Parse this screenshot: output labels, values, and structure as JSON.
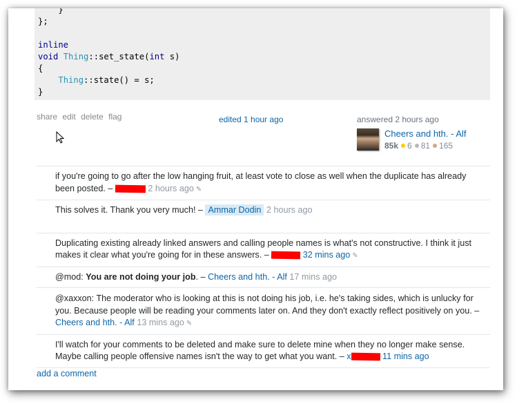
{
  "code": {
    "lines": [
      [
        {
          "t": "    }",
          "c": ""
        }
      ],
      [
        {
          "t": "};",
          "c": ""
        }
      ],
      [
        {
          "t": "",
          "c": ""
        }
      ],
      [
        {
          "t": "inline",
          "c": "kw"
        }
      ],
      [
        {
          "t": "void",
          "c": "kw"
        },
        {
          "t": " ",
          "c": ""
        },
        {
          "t": "Thing",
          "c": "ty"
        },
        {
          "t": "::set_state(",
          "c": ""
        },
        {
          "t": "int",
          "c": "kw"
        },
        {
          "t": " s)",
          "c": ""
        }
      ],
      [
        {
          "t": "{",
          "c": ""
        }
      ],
      [
        {
          "t": "    ",
          "c": ""
        },
        {
          "t": "Thing",
          "c": "ty"
        },
        {
          "t": "::state() = s;",
          "c": ""
        }
      ],
      [
        {
          "t": "}",
          "c": ""
        }
      ]
    ]
  },
  "post_menu": {
    "share": "share",
    "edit": "edit",
    "delete": "delete",
    "flag": "flag"
  },
  "edited": "edited 1 hour ago",
  "signature": {
    "answered": "answered 2 hours ago",
    "user_name": "Cheers and hth. - Alf",
    "reputation": "85k",
    "gold": "6",
    "silver": "81",
    "bronze": "165"
  },
  "comments": [
    {
      "text": "if you're going to go after the low hanging fruit, at least vote to close as well when the duplicate has already been posted. –",
      "user": "",
      "time": "2 hours ago",
      "redacted": true,
      "edited": true
    },
    {
      "text": "This solves it. Thank you very much! –",
      "user": "Ammar Dodin",
      "time": "2 hours ago",
      "redacted": false,
      "edited": false
    },
    {
      "text": "Duplicating existing already linked answers and calling people names is what's not constructive. I think it just makes it clear what you're going for in these answers. –",
      "user": "",
      "time": "32 mins ago",
      "redacted": true,
      "edited": true
    },
    {
      "prefix": "@mod: ",
      "bold": "You are not doing your job",
      "text": ". –",
      "user": "Cheers and hth. - Alf",
      "time": "17 mins ago",
      "redacted": false,
      "edited": false
    },
    {
      "text": "@xaxxon: The moderator who is looking at this is not doing his job, i.e. he's taking sides, which is unlucky for you. Because people will be reading your comments later on. And they don't exactly reflect positively on you. –",
      "user": "Cheers and hth. - Alf",
      "time": "13 mins ago",
      "redacted": false,
      "edited": true
    },
    {
      "text": "I'll watch for your comments to be deleted and make sure to delete mine when they no longer make sense. Maybe calling people offensive names isn't the way to get what you want. –",
      "user": "x",
      "time": "11 mins ago",
      "redacted": true,
      "edited": false
    }
  ],
  "add_comment": "add a comment",
  "icons": {
    "pencil": "✎",
    "cursor": "arrow-cursor"
  }
}
